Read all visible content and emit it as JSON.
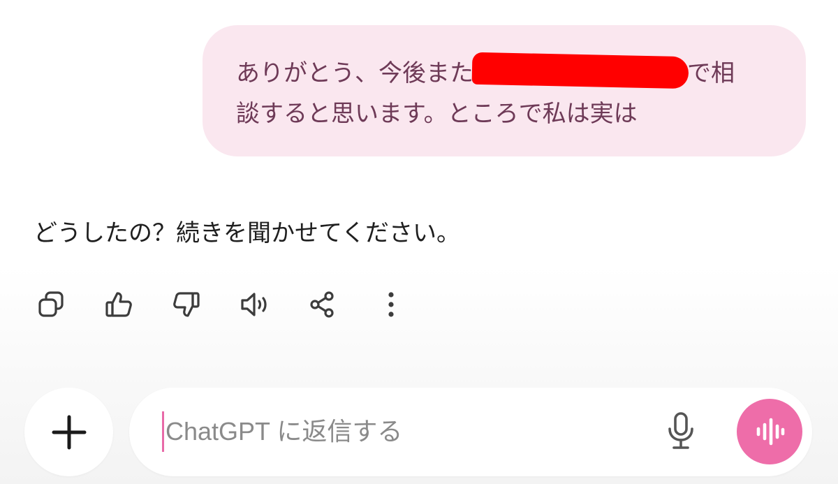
{
  "user_message": {
    "line1_before": "ありがとう、今後また",
    "line1_after": "で相",
    "line2": "談すると思います。ところで私は実は"
  },
  "assistant_message": {
    "text": "どうしたの？続きを聞かせてください。"
  },
  "message_actions": [
    {
      "icon": "copy-icon"
    },
    {
      "icon": "thumbs-up-icon"
    },
    {
      "icon": "thumbs-down-icon"
    },
    {
      "icon": "speaker-icon"
    },
    {
      "icon": "share-icon"
    },
    {
      "icon": "more-vertical-icon"
    }
  ],
  "composer": {
    "placeholder": "ChatGPT に返信する",
    "value": "",
    "add_icon": "plus-icon",
    "mic_icon": "mic-icon",
    "voice_icon": "voice-waveform-icon"
  },
  "colors": {
    "user_bubble_bg": "#fae7ef",
    "user_bubble_text": "#6e3a57",
    "accent": "#ee6da9",
    "redaction": "#ff0000",
    "icon": "#3c3c3c"
  }
}
